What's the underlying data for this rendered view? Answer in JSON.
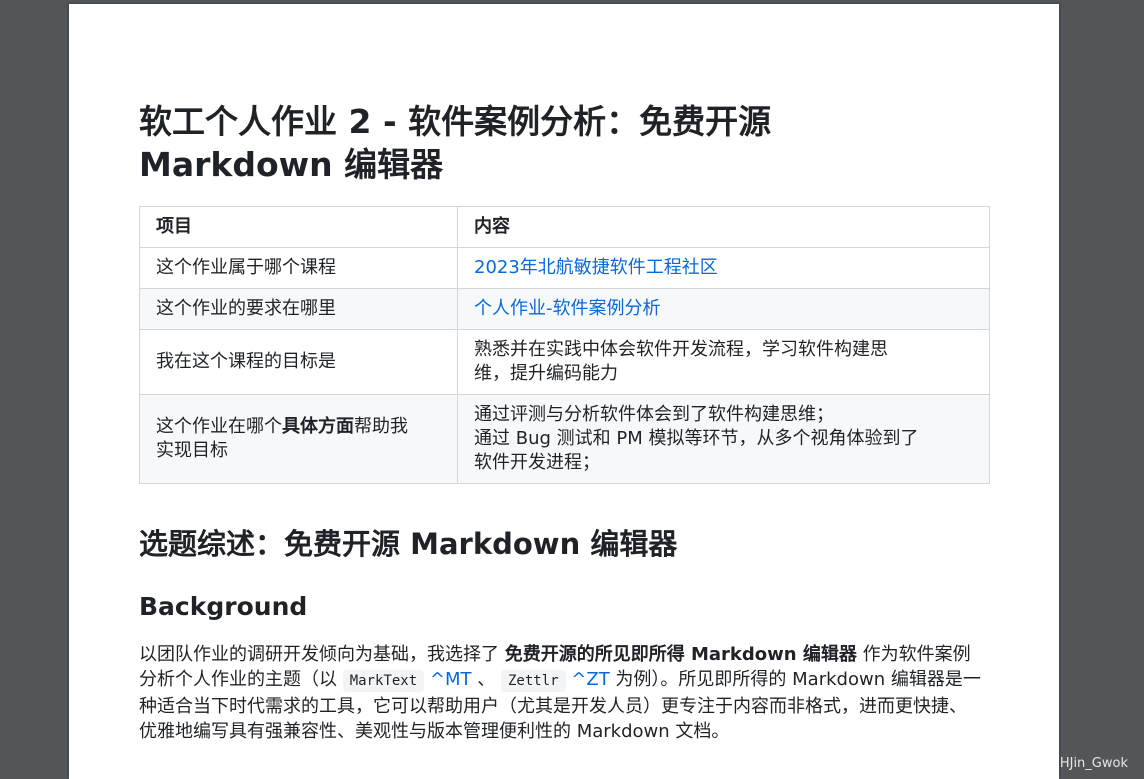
{
  "document": {
    "title_line1": "软工个人作业 2 - 软件案例分析：免费开源",
    "title_line2": "Markdown 编辑器",
    "table": {
      "headers": [
        "项目",
        "内容"
      ],
      "rows": [
        {
          "item": "这个作业属于哪个课程",
          "content": "2023年北航敏捷软件工程社区"
        },
        {
          "item": "这个作业的要求在哪里",
          "content": "个人作业-软件案例分析"
        },
        {
          "item": "我在这个课程的目标是",
          "content_line1": "熟悉并在实践中体会软件开发流程，学习软件构建思",
          "content_line2": "维，提升编码能力"
        },
        {
          "item_prefix": "这个作业在哪个",
          "item_bold": "具体方面",
          "item_suffix": "帮助我",
          "item_line2": "实现目标",
          "content_line1": "通过评测与分析软件体会到了软件构建思维；",
          "content_line2": "通过 Bug 测试和 PM 模拟等环节，从多个视角体验到了",
          "content_line3": "软件开发进程；"
        }
      ]
    },
    "section_heading": "选题综述：免费开源 Markdown 编辑器",
    "subsection_heading": "Background",
    "paragraph": {
      "t1": "以团队作业的调研开发倾向为基础，我选择了 ",
      "bold": "免费开源的所见即所得 Markdown 编辑器",
      "t2": " 作为软件案例分析个人作业的主题（以 ",
      "code1": "MarkText",
      "ref1": "^MT",
      "t3": " 、 ",
      "code2": "Zettlr",
      "ref2": "^ZT",
      "t4": " 为例）。所见即所得的 Markdown 编辑器是一种适合当下时代需求的工具，它可以帮助用户（尤其是开发人员）更专注于内容而非格式，进而更快捷、优雅地编写具有强兼容性、美观性与版本管理便利性的 Markdown 文档。"
    }
  },
  "watermark": "CSDN @HJin_Gwok",
  "colors": {
    "link": "#0969da",
    "viewer_bg": "#525659",
    "table_border": "#d0d7de"
  }
}
